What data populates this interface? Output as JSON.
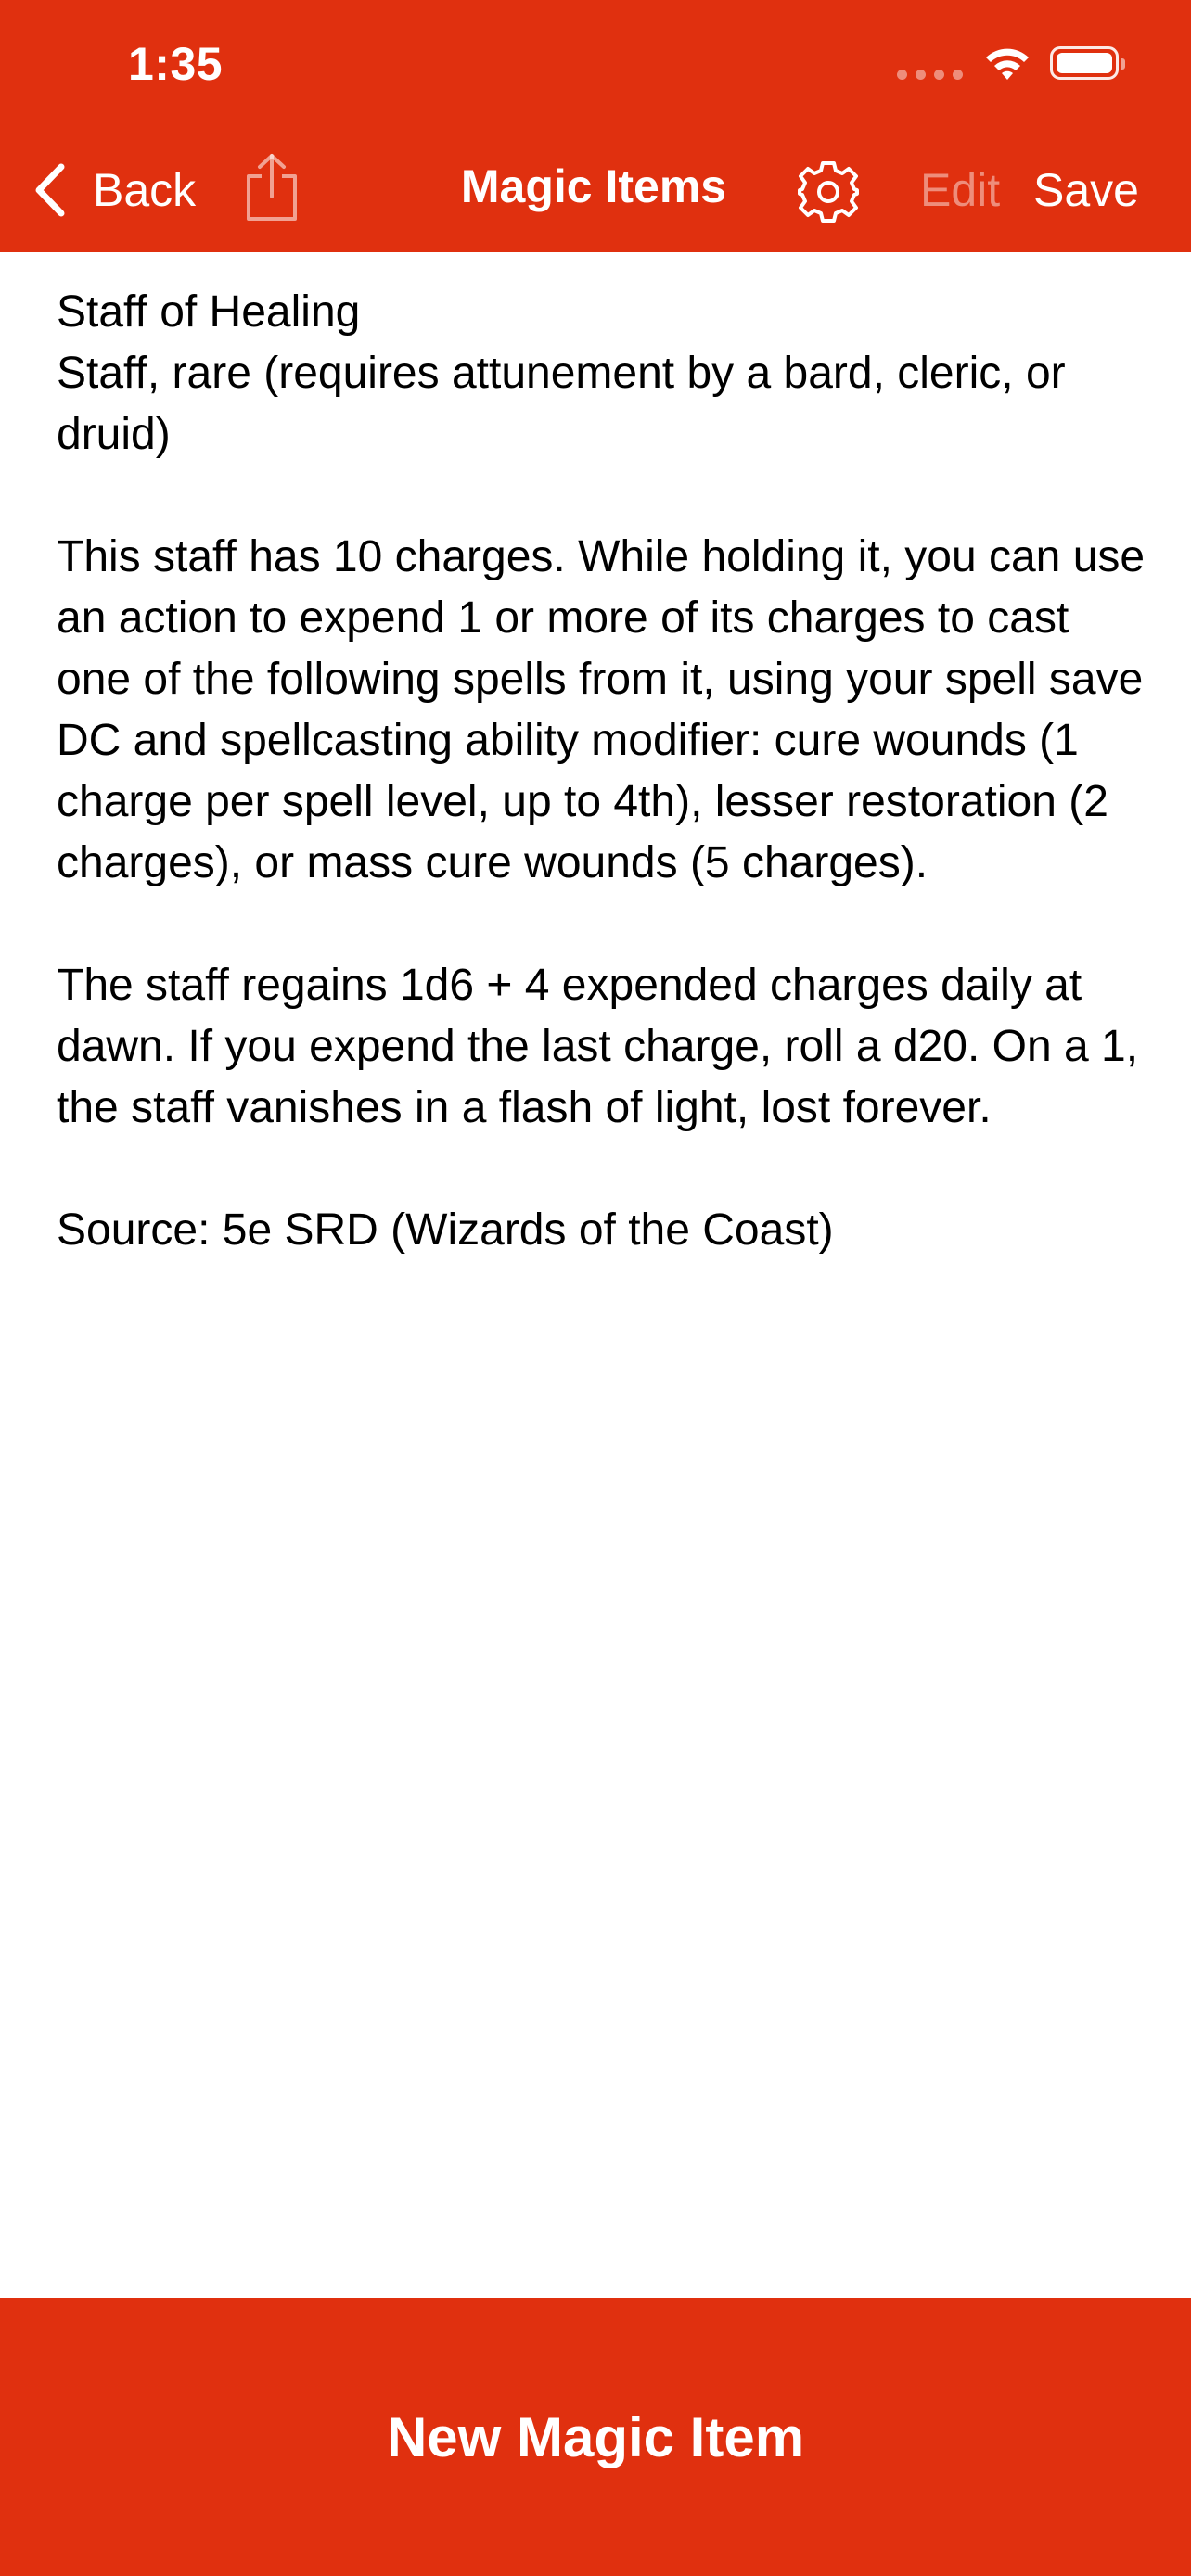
{
  "status_bar": {
    "time": "1:35"
  },
  "nav": {
    "back_label": "Back",
    "title": "Magic Items",
    "edit_label": "Edit",
    "save_label": "Save",
    "icons": [
      "chevron-left-icon",
      "share-icon",
      "gear-icon"
    ]
  },
  "item": {
    "name": "Staff of Healing",
    "subtitle": "Staff, rare (requires attunement by a bard, cleric, or druid)",
    "paragraph_1": "This staff has 10 charges. While holding it, you can use an action to expend 1 or more of its charges to cast one of the following spells from it, using your spell save DC and spellcasting ability modifier: cure wounds (1 charge per spell level, up to 4th), lesser restoration (2 charges), or mass cure wounds (5 charges).",
    "paragraph_2": "The staff regains 1d6 + 4 expended charges daily at dawn. If you expend the last charge, roll a d20. On a 1, the staff vanishes in a flash of light, lost forever.",
    "source": "Source: 5e SRD (Wizards of the Coast)"
  },
  "footer": {
    "button_label": "New Magic Item"
  },
  "colors": {
    "accent": "#E0300F",
    "text": "#000000",
    "background": "#FFFFFF"
  }
}
